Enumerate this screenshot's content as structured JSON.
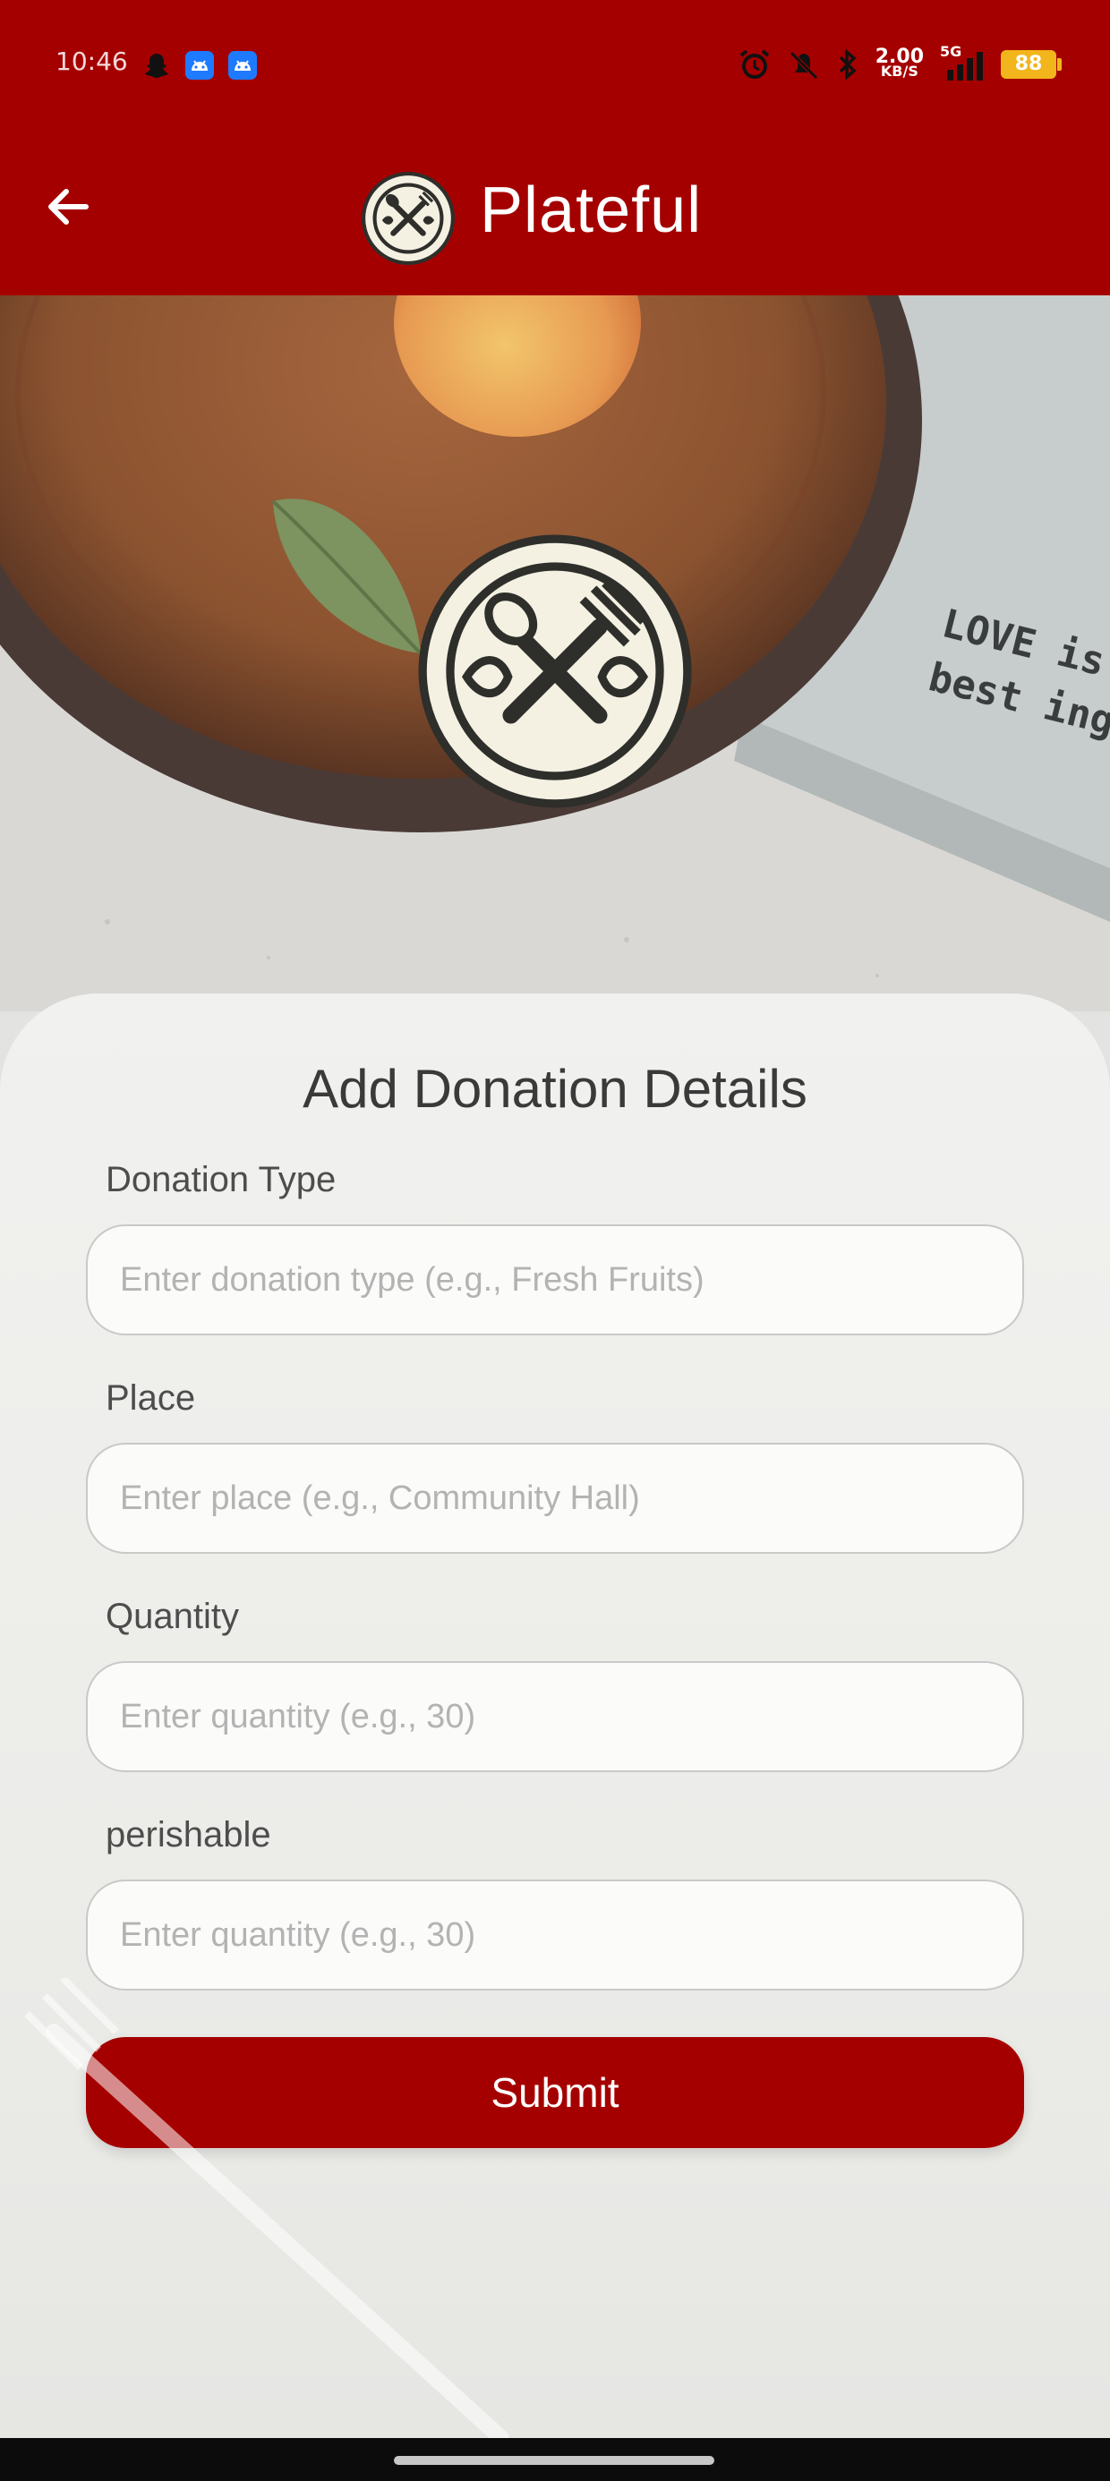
{
  "status_bar": {
    "time": "10:46",
    "net_speed_value": "2.00",
    "net_speed_unit": "KB/S",
    "network_label": "5G",
    "battery": "88"
  },
  "app_bar": {
    "title": "Plateful"
  },
  "form": {
    "title": "Add Donation Details",
    "fields": [
      {
        "label": "Donation Type",
        "placeholder": "Enter donation type (e.g., Fresh Fruits)",
        "value": ""
      },
      {
        "label": "Place",
        "placeholder": "Enter place (e.g., Community Hall)",
        "value": ""
      },
      {
        "label": "Quantity",
        "placeholder": "Enter quantity (e.g., 30)",
        "value": ""
      },
      {
        "label": "perishable",
        "placeholder": "Enter quantity (e.g., 30)",
        "value": ""
      }
    ],
    "submit_label": "Submit"
  },
  "hero": {
    "napkin_text_line1": "LOVE is",
    "napkin_text_line2": "best ingre"
  },
  "colors": {
    "brand": "#a50000",
    "logo_fill": "#f4f1e2",
    "logo_stroke": "#2e2e2b"
  },
  "icons": {
    "back": "arrow-left-icon",
    "logo": "spoon-fork-leaf-icon"
  }
}
